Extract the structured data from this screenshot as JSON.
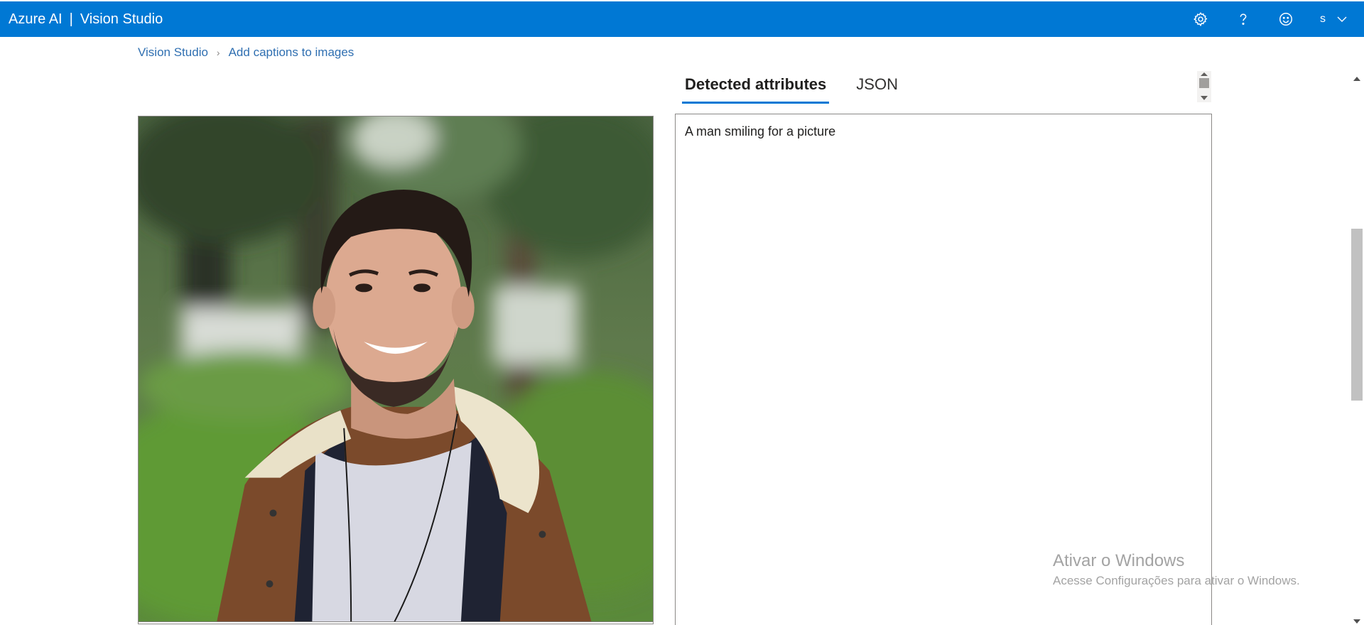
{
  "header": {
    "brand": "Azure AI",
    "separator": "|",
    "product": "Vision Studio",
    "icons": [
      "settings-gear-icon",
      "help-question-icon",
      "feedback-smiley-icon",
      "chevron-down-icon"
    ],
    "account_initial": "s",
    "accent_color": "#0078d4"
  },
  "breadcrumb": {
    "items": [
      {
        "label": "Vision Studio"
      },
      {
        "label": "Add captions to images"
      }
    ],
    "separator_icon": "chevron-right-icon"
  },
  "main": {
    "image": {
      "subject": "portrait-photo"
    },
    "tabs": [
      {
        "label": "Detected attributes",
        "active": true
      },
      {
        "label": "JSON",
        "active": false
      }
    ],
    "result": {
      "caption": "A man smiling for a picture"
    }
  },
  "watermark": {
    "line1": "Ativar o Windows",
    "line2": "Acesse Configurações para ativar o Windows."
  }
}
